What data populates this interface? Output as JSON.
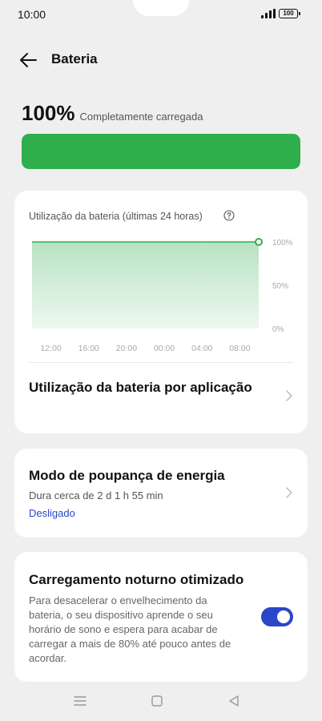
{
  "status_bar": {
    "time": "10:00",
    "battery_text": "100",
    "signal_icon": "signal-bars-icon",
    "battery_icon": "battery-icon"
  },
  "header": {
    "back_icon": "arrow-left-icon",
    "title": "Bateria"
  },
  "battery": {
    "level": "100%",
    "status": "Completamente carregada",
    "level_fraction": 1.0,
    "bar_color": "#2eaf4b"
  },
  "usage_card": {
    "title": "Utilização da bateria (últimas 24 horas)",
    "help_icon": "help-circle-icon",
    "app_usage_label": "Utilização da bateria por aplicação",
    "chevron_icon": "chevron-right-icon"
  },
  "chart_data": {
    "type": "area",
    "title": "",
    "xlabel": "",
    "ylabel": "",
    "x": [
      "10:00",
      "12:00",
      "14:00",
      "16:00",
      "18:00",
      "20:00",
      "22:00",
      "00:00",
      "02:00",
      "04:00",
      "06:00",
      "08:00",
      "10:00"
    ],
    "values": [
      100,
      100,
      100,
      100,
      100,
      100,
      100,
      100,
      100,
      100,
      100,
      100,
      100
    ],
    "x_tick_labels": [
      "12:00",
      "16:00",
      "20:00",
      "00:00",
      "04:00",
      "08:00"
    ],
    "y_tick_labels": [
      "100%",
      "50%",
      "0%"
    ],
    "ylim": [
      0,
      100
    ],
    "grid": false,
    "line_color": "#2eaf4b"
  },
  "power_saver": {
    "title": "Modo de poupança de energia",
    "duration": "Dura cerca de 2 d 1 h 55 min",
    "state": "Desligado",
    "chevron_icon": "chevron-right-icon"
  },
  "night_charging": {
    "title": "Carregamento noturno otimizado",
    "description": "Para desacelerar o envelhecimento da bateria, o seu dispositivo aprende o seu horário de sono e espera para acabar de carregar a mais de 80% até pouco antes de acordar.",
    "enabled": true,
    "toggle_color": "#2a47c8"
  },
  "nav_bar": {
    "menu_icon": "menu-icon",
    "home_icon": "home-square-icon",
    "back_icon": "back-triangle-icon"
  }
}
